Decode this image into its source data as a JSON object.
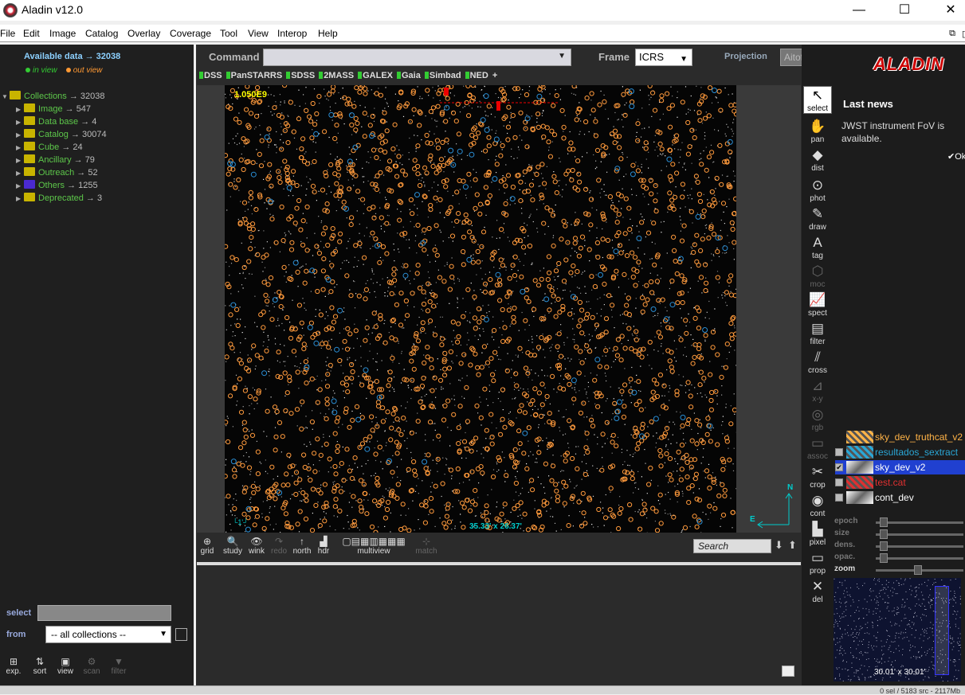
{
  "window": {
    "title": "Aladin v12.0",
    "minimize": "—",
    "maximize": "☐",
    "close": "✕"
  },
  "menu": [
    "File",
    "Edit",
    "Image",
    "Catalog",
    "Overlay",
    "Coverage",
    "Tool",
    "View",
    "Interop",
    "Help"
  ],
  "left": {
    "available": "Available data → 32038",
    "in_view": "in view",
    "out_view": "out view",
    "colors": {
      "in_view": "#33cc33",
      "out_view": "#ff9933",
      "label": "#5dc74a"
    },
    "tree": [
      {
        "label": "Collections",
        "count": " → 32038",
        "folder": "#c8b400",
        "expanded": true
      },
      {
        "label": "Image",
        "count": " → 547",
        "folder": "#c8b400"
      },
      {
        "label": "Data base",
        "count": " → 4",
        "folder": "#c8b400"
      },
      {
        "label": "Catalog",
        "count": " → 30074",
        "folder": "#c8b400"
      },
      {
        "label": "Cube",
        "count": " → 24",
        "folder": "#c8b400"
      },
      {
        "label": "Ancillary",
        "count": " → 79",
        "folder": "#c8b400"
      },
      {
        "label": "Outreach",
        "count": " → 52",
        "folder": "#c8b400"
      },
      {
        "label": "Others",
        "count": " → 1255",
        "folder": "#4a2ad0"
      },
      {
        "label": "Deprecated",
        "count": " → 3",
        "folder": "#c8b400"
      }
    ],
    "select_label": "select",
    "from_label": "from",
    "from_value": "-- all collections --",
    "tools": [
      {
        "icon": "⊞",
        "label": "exp.",
        "enabled": true
      },
      {
        "icon": "⇅",
        "label": "sort",
        "enabled": true
      },
      {
        "icon": "▣",
        "label": "view",
        "enabled": true
      },
      {
        "icon": "⚙",
        "label": "scan",
        "enabled": false
      },
      {
        "icon": "▼",
        "label": "filter",
        "enabled": false
      }
    ]
  },
  "main": {
    "command_label": "Command",
    "frame_label": "Frame",
    "frame_value": "ICRS",
    "projection_label": "Projection",
    "projection_value": "Aitoff",
    "surveys": [
      "DSS",
      "PanSTARRS",
      "SDSS",
      "2MASS",
      "GALEX",
      "Gaia",
      "Simbad",
      "NED",
      "+"
    ],
    "pixel_scale": "1.050E9",
    "fov": "35.33' x 26.37'",
    "scale_bar": "1'",
    "compass_n": "N",
    "compass_e": "E",
    "view_tools": [
      {
        "icon": "⊕",
        "label": "grid",
        "enabled": true
      },
      {
        "icon": "🔍",
        "label": "study",
        "enabled": true
      },
      {
        "icon": "👁",
        "label": "wink",
        "enabled": true
      },
      {
        "icon": "↷",
        "label": "redo",
        "enabled": false
      },
      {
        "icon": "↑",
        "label": "north",
        "enabled": true
      },
      {
        "icon": "▟",
        "label": "hdr",
        "enabled": true
      },
      {
        "icon": "▢▤▦▥▦▦▦",
        "label": "multiview",
        "enabled": true
      },
      {
        "icon": "⊹",
        "label": "match",
        "enabled": false
      }
    ],
    "search_placeholder": "Search"
  },
  "toolbar": [
    {
      "icon": "↖",
      "label": "select",
      "enabled": true
    },
    {
      "icon": "✋",
      "label": "pan",
      "enabled": true
    },
    {
      "icon": "◆",
      "label": "dist",
      "enabled": true
    },
    {
      "icon": "⊙",
      "label": "phot",
      "enabled": true
    },
    {
      "icon": "✎",
      "label": "draw",
      "enabled": true
    },
    {
      "icon": "A",
      "label": "tag",
      "enabled": true
    },
    {
      "icon": "⬡",
      "label": "moc",
      "enabled": false
    },
    {
      "icon": "📈",
      "label": "spect",
      "enabled": true
    },
    {
      "icon": "▤",
      "label": "filter",
      "enabled": true
    },
    {
      "icon": "⫽",
      "label": "cross",
      "enabled": true
    },
    {
      "icon": "⊿",
      "label": "x-y",
      "enabled": false
    },
    {
      "icon": "◎",
      "label": "rgb",
      "enabled": false
    },
    {
      "icon": "▭",
      "label": "assoc",
      "enabled": false
    },
    {
      "icon": "✂",
      "label": "crop",
      "enabled": true
    },
    {
      "icon": "◉",
      "label": "cont",
      "enabled": true
    },
    {
      "icon": "▙",
      "label": "pixel",
      "enabled": true
    },
    {
      "icon": "▭",
      "label": "prop",
      "enabled": true
    },
    {
      "icon": "✕",
      "label": "del",
      "enabled": true
    }
  ],
  "right": {
    "logo": "ALADIN",
    "news_title": "Last news",
    "news_body": "JWST instrument FoV is available.",
    "news_ok": "✔Ok",
    "planes": [
      {
        "name": "sky_dev_truthcat_v2",
        "color": "#ffb347",
        "checked": false,
        "selected": false,
        "checkbox": false
      },
      {
        "name": "resultados_sextract",
        "color": "#2aa7d6",
        "checked": false,
        "selected": false,
        "checkbox": true
      },
      {
        "name": "sky_dev_v2",
        "color": "#ffffff",
        "checked": true,
        "selected": true,
        "checkbox": true
      },
      {
        "name": "test.cat",
        "color": "#e03030",
        "checked": false,
        "selected": false,
        "checkbox": true
      },
      {
        "name": "cont_dev",
        "color": "#ffffff",
        "checked": false,
        "selected": false,
        "checkbox": true
      }
    ],
    "sliders": [
      "epoch",
      "size",
      "dens.",
      "opac.",
      "zoom"
    ],
    "minimap_fov": "30.01' x 30.01'"
  },
  "status": "0 sel / 5183 src - 2117Mb"
}
